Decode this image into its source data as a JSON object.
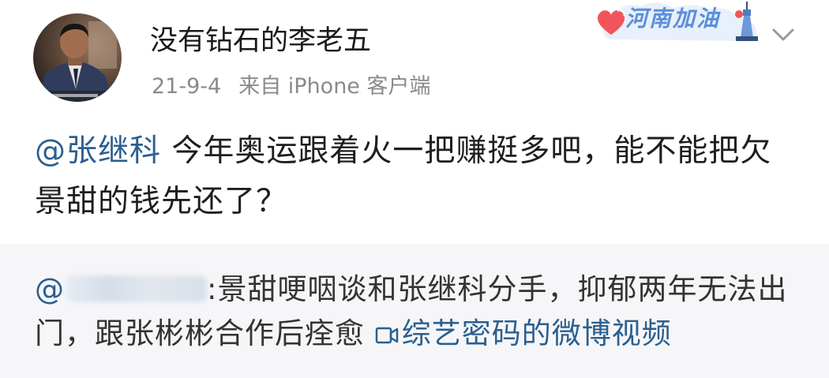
{
  "post": {
    "username": "没有钻石的李老五",
    "date": "21-9-4",
    "source": "来自 iPhone 客户端",
    "badge_text": "河南加油",
    "content_mention": "@张继科",
    "content_text": " 今年奥运跟着火一把赚挺多吧，能不能把欠景甜的钱先还了？"
  },
  "repost": {
    "at": "@",
    "text": ":景甜哽咽谈和张继科分手，抑郁两年无法出门，跟张彬彬合作后痊愈 ",
    "video_link": "综艺密码的微博视频"
  },
  "colors": {
    "link": "#2b5f8f",
    "meta_gray": "#8a8a8a",
    "repost_bg": "#f6f6f8",
    "badge_blue": "#5b8fd9",
    "badge_heart": "#f2545b"
  },
  "icons": {
    "avatar": "avatar-photo",
    "badge_heart": "heart-icon",
    "badge_tower": "tower-icon",
    "menu": "chevron-down-icon",
    "video": "video-icon"
  }
}
